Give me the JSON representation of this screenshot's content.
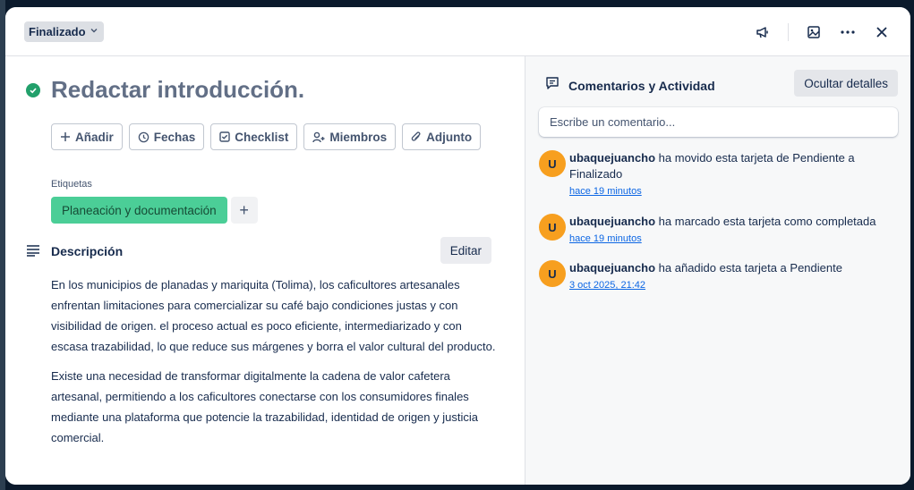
{
  "header": {
    "status_label": "Finalizado",
    "icons": [
      "megaphone-icon",
      "image-icon",
      "more-icon",
      "close-icon"
    ]
  },
  "card": {
    "title": "Redactar introducción.",
    "completed": true
  },
  "actions": [
    {
      "label": "Añadir",
      "icon": "plus-icon"
    },
    {
      "label": "Fechas",
      "icon": "clock-icon"
    },
    {
      "label": "Checklist",
      "icon": "checkbox-icon"
    },
    {
      "label": "Miembros",
      "icon": "add-member-icon"
    },
    {
      "label": "Adjunto",
      "icon": "paperclip-icon"
    }
  ],
  "labels": {
    "title": "Etiquetas",
    "items": [
      {
        "text": "Planeación y documentación",
        "color": "#4bce97"
      }
    ],
    "add_symbol": "+"
  },
  "description": {
    "title": "Descripción",
    "edit_label": "Editar",
    "paragraphs": [
      "En los municipios de planadas y mariquita (Tolima), los caficultores artesanales enfrentan limitaciones para comercializar su café bajo condiciones justas y con visibilidad de origen. el proceso actual es poco eficiente, intermediarizado y con escasa trazabilidad, lo que reduce sus márgenes y borra el valor cultural del producto.",
      "Existe una necesidad de transformar digitalmente la cadena de valor cafetera artesanal, permitiendo a los caficultores conectarse con los consumidores finales mediante una plataforma que potencie la trazabilidad, identidad de origen y justicia comercial."
    ]
  },
  "sidebar": {
    "title": "Comentarios y Actividad",
    "hide_label": "Ocultar detalles",
    "comment_placeholder": "Escribe un comentario...",
    "activity": [
      {
        "avatar": "U",
        "user": "ubaquejuancho",
        "text": " ha movido esta tarjeta de Pendiente a Finalizado",
        "time": "hace 19 minutos"
      },
      {
        "avatar": "U",
        "user": "ubaquejuancho",
        "text": " ha marcado esta tarjeta como completada",
        "time": "hace 19 minutos"
      },
      {
        "avatar": "U",
        "user": "ubaquejuancho",
        "text": " ha añadido esta tarjeta a Pendiente",
        "time": "3 oct 2025, 21:42"
      }
    ]
  },
  "colors": {
    "completed_green": "#22a06b",
    "label_green": "#4bce97",
    "avatar_orange": "#f79f1f",
    "link_blue": "#0c66e4"
  }
}
